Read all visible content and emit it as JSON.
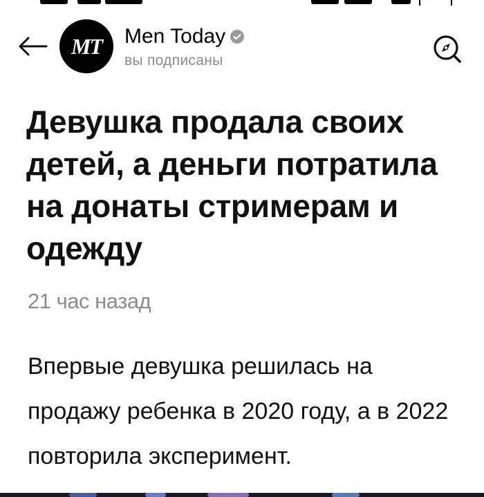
{
  "header": {
    "avatar_initials": "MT",
    "channel_name": "Men Today",
    "subscription_status": "вы подписаны"
  },
  "icons": {
    "back": "arrow-left-icon",
    "verified": "verified-check-icon",
    "explore": "compass-icon"
  },
  "article": {
    "title": "Девушка продала своих детей, а деньги потратила на донаты стримерам и одежду",
    "timestamp": "21 час назад",
    "body": "Впервые девушка решилась на продажу ребенка в 2020 году, а в 2022 повторила эксперимент."
  },
  "colors": {
    "text": "#111111",
    "muted": "#8c8c8c",
    "avatar_bg": "#000000",
    "verified_badge": "#9a9a9a"
  }
}
